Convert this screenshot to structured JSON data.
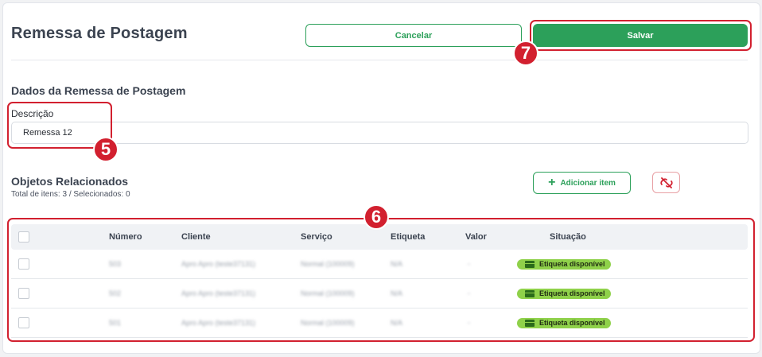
{
  "header": {
    "title": "Remessa de Postagem",
    "cancel_label": "Cancelar",
    "save_label": "Salvar"
  },
  "section": {
    "title": "Dados da Remessa de Postagem"
  },
  "description_field": {
    "label": "Descrição",
    "value": "Remessa 12"
  },
  "objects": {
    "title": "Objetos Relacionados",
    "subtitle": "Total de itens: 3 / Selecionados: 0",
    "add_label": "Adicionar item",
    "unlink_icon": "unlink-icon"
  },
  "table": {
    "columns": [
      "Número",
      "Cliente",
      "Serviço",
      "Etiqueta",
      "Valor",
      "Situação"
    ],
    "rows": [
      {
        "numero": "503",
        "cliente": "Apro Apro (teste37131)",
        "servico": "Normal (100009)",
        "etiqueta": "N/A",
        "valor": "-",
        "situacao": "Etiqueta disponível"
      },
      {
        "numero": "502",
        "cliente": "Apro Apro (teste37131)",
        "servico": "Normal (100009)",
        "etiqueta": "N/A",
        "valor": "-",
        "situacao": "Etiqueta disponível"
      },
      {
        "numero": "501",
        "cliente": "Apro Apro (teste37131)",
        "servico": "Normal (100009)",
        "etiqueta": "N/A",
        "valor": "-",
        "situacao": "Etiqueta disponível"
      }
    ]
  },
  "annotations": {
    "n5": "5",
    "n6": "6",
    "n7": "7"
  },
  "colors": {
    "primary_green": "#2ca05a",
    "badge_green": "#8fd14a",
    "annotation_red": "#d2202f"
  }
}
